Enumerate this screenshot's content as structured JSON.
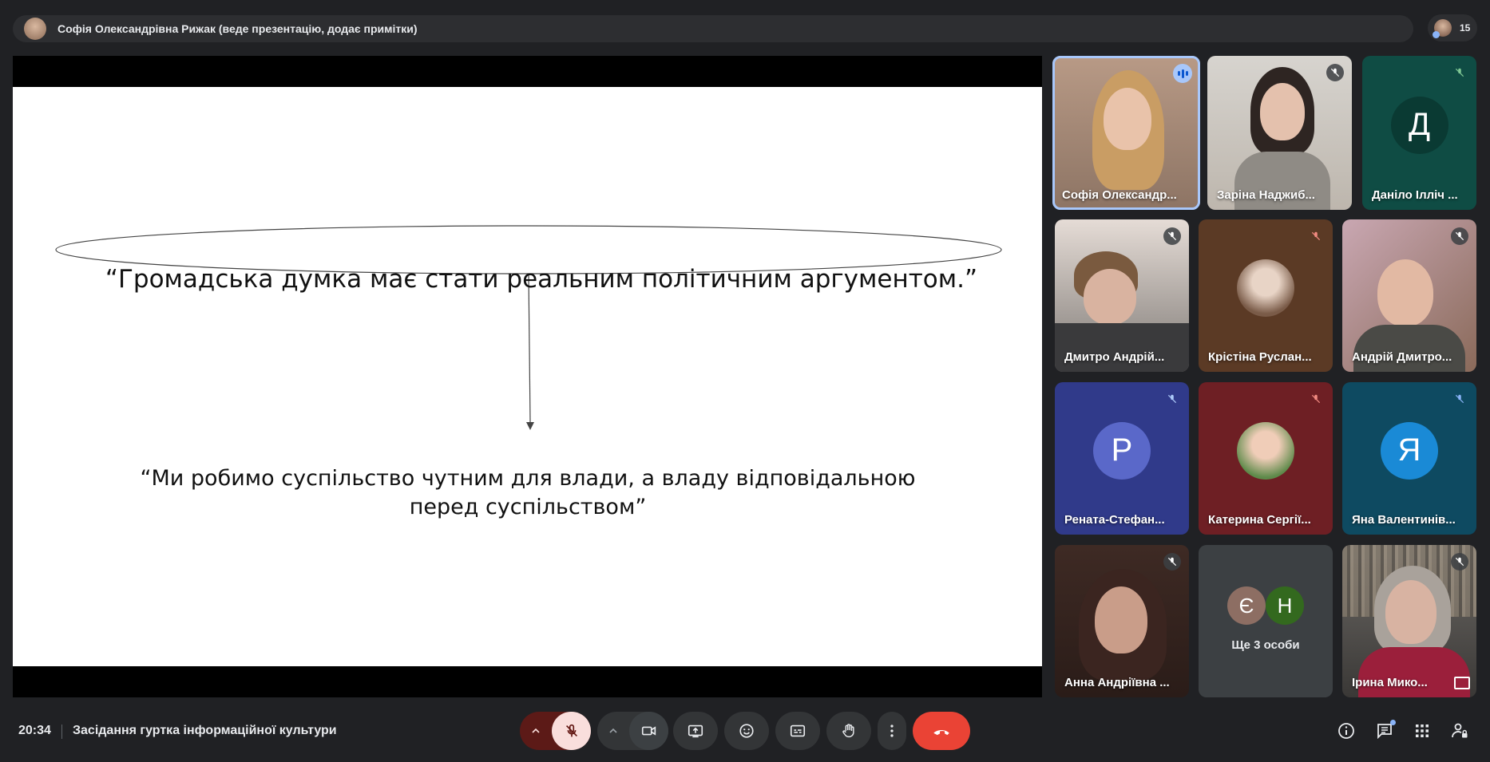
{
  "presenter_bar": {
    "text": "Софія Олександрівна Рижак (веде презентацію, додає примітки)",
    "participant_count": "15"
  },
  "slide": {
    "quote_top": "“Громадська думка має стати реальним політичним аргументом.”",
    "quote_bottom_line1": "“Ми робимо суспільство чутним для влади, а владу відповідальною",
    "quote_bottom_line2": "перед суспільством”"
  },
  "tiles": [
    {
      "name": "Софія Олександр...",
      "state": "speaking"
    },
    {
      "name": "Заріна Наджиб...",
      "state": "muted"
    },
    {
      "name": "Даніло Ілліч ...",
      "letter": "Д",
      "state": "muted"
    },
    {
      "name": "Дмитро Андрій...",
      "state": "muted"
    },
    {
      "name": "Крістіна Руслан...",
      "state": "muted"
    },
    {
      "name": "Андрій Дмитро...",
      "state": "muted"
    },
    {
      "name": "Рената-Стефан...",
      "letter": "Р",
      "state": "muted"
    },
    {
      "name": "Катерина Сергії...",
      "state": "muted"
    },
    {
      "name": "Яна Валентинів...",
      "letter": "Я",
      "state": "muted"
    },
    {
      "name": "Анна Андріївна ...",
      "state": "muted"
    },
    {
      "name": "Ще 3 особи",
      "letters": [
        "Є",
        "Н"
      ]
    },
    {
      "name": "Ірина Мико...",
      "state": "muted"
    }
  ],
  "bottom": {
    "time": "20:34",
    "meeting_title": "Засідання гуртка інформаційної культури"
  },
  "colors": {
    "background": "#202124",
    "leave_button": "#ea4335",
    "mic_off_button": "#f9dedc",
    "active_outline": "#a8c7fa"
  }
}
